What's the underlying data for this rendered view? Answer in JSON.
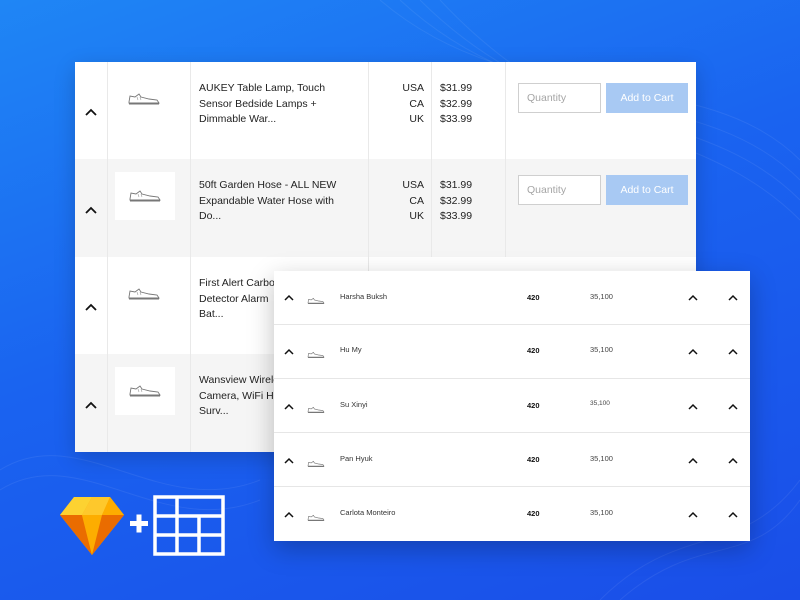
{
  "colors": {
    "background_start": "#1f86f5",
    "background_end": "#1a4ee8",
    "cart_button": "#a8c9f3",
    "sketch_gold": "#f7b500"
  },
  "icons": {
    "expand": "chevron-up-icon",
    "product": "sneaker-icon",
    "sketch": "sketch-diamond-icon",
    "grid": "table-grid-icon"
  },
  "products": [
    {
      "title_lines": [
        "AUKEY Table Lamp, Touch",
        "Sensor Bedside Lamps +",
        "Dimmable War..."
      ],
      "countries": [
        "USA",
        "CA",
        "UK"
      ],
      "prices": [
        "$31.99",
        "$32.99",
        "$33.99"
      ],
      "quantity_placeholder": "Quantity",
      "button_label": "Add to Cart"
    },
    {
      "title_lines": [
        "50ft Garden Hose - ALL NEW",
        "Expandable Water Hose with",
        "Do..."
      ],
      "countries": [
        "USA",
        "CA",
        "UK"
      ],
      "prices": [
        "$31.99",
        "$32.99",
        "$33.99"
      ],
      "quantity_placeholder": "Quantity",
      "button_label": "Add to Cart"
    },
    {
      "title_lines": [
        "First Alert Carbo",
        "Detector Alarm",
        "Bat..."
      ]
    },
    {
      "title_lines": [
        "Wansview Wirele",
        "Camera, WiFi H",
        "Surv..."
      ]
    }
  ],
  "people": [
    {
      "name": "Harsha Buksh",
      "score": "420",
      "count": "35,100"
    },
    {
      "name": "Hu My",
      "score": "420",
      "count": "35,100"
    },
    {
      "name": "Su Xinyi",
      "score": "420",
      "count": "35,100"
    },
    {
      "name": "Pan Hyuk",
      "score": "420",
      "count": "35,100"
    },
    {
      "name": "Carlota Monteiro",
      "score": "420",
      "count": "35,100"
    }
  ]
}
